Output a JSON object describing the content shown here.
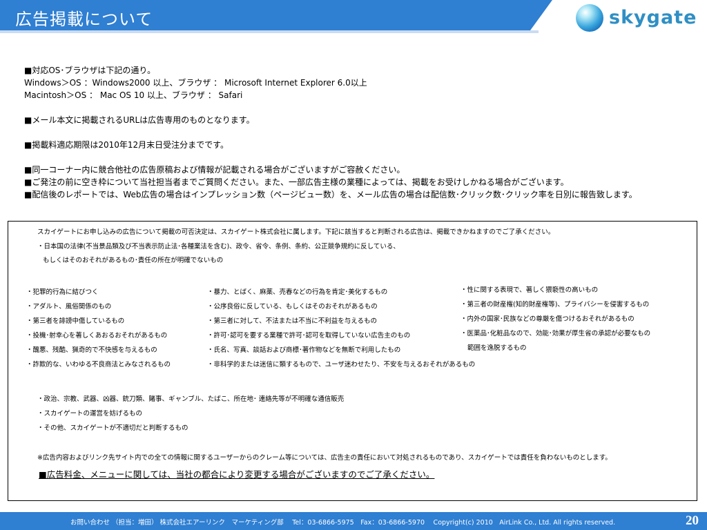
{
  "header": {
    "title": "広告掲載について",
    "logo_text": "skygate"
  },
  "info": {
    "lines": [
      "■対応OS･ブラウザは下記の通り。",
      "Windows＞OS ：Windows2000 以上、ブラウザ ： Microsoft Internet Explorer 6.0以上",
      "Macintosh＞OS ： Mac OS 10 以上、ブラウザ ： Safari",
      "■メール本文に掲載されるURLは広告専用のものとなります。",
      "■掲載料適応期限は2010年12月末日受注分までです。",
      "■同一コーナー内に競合他社の広告原稿および情報が記載される場合がございますがご容赦ください。",
      "■ご発注の前に空き枠について当社担当者までご質問ください。また、一部広告主様の業種によっては、掲載をお受けしかねる場合がございます。",
      "■配信後のレポートでは、Web広告の場合はインプレッション数（ページビュー数）を、メール広告の場合は配信数･クリック数･クリック率を日別に報告致します。"
    ]
  },
  "box": {
    "intro": "スカイゲートにお申し込みの広告について掲載の可否決定は、スカイゲート株式会社に属します。下記に該当すると判断される広告は、掲載できかねますのでご了承ください。",
    "law_line1": "・日本国の法律(不当景品類及び不当表示防止法･各種業法を含む)、政令、省令、条例、条約、公正競争規約に反している、",
    "law_line2": "もしくはそのおそれがあるもの･責任の所在が明確でないもの",
    "col1": [
      "・犯罪的行為に結びつく",
      "・アダルト、風俗関係のもの",
      "・第三者を誹謗中傷しているもの",
      "・投機･射幸心を著しくあおるおそれがあるもの",
      "・醜悪、残酷、猟奇的で不快感を与えるもの",
      "・詐欺的な、いわゆる不良商法とみなされるもの"
    ],
    "col2": [
      "・暴力、とばく、麻薬、売春などの行為を肯定･美化するもの",
      "・公序良俗に反している、もしくはそのおそれがあるもの",
      "・第三者に対して、不法または不当に不利益を与えるもの",
      "・許可･認可を要する業種で許可･認可を取得していない広告主のもの",
      "・氏名、写真、談話および商標･著作物などを無断で利用したもの",
      "・非科学的または迷信に類するもので、ユーザ迷わせたり、不安を与えるおそれがあるもの"
    ],
    "col3": [
      "・性に関する表現で、著しく猥褻性の高いもの",
      "・第三者の財産権(知的財産権等)、プライバシーを侵害するもの",
      "・内外の国家･民族などの尊厳を傷つけるおそれがあるもの",
      "・医薬品･化粧品なので、効能･効果が厚生省の承認が必要なもの",
      "範囲を逸脱するもの"
    ],
    "misc": [
      "・政治、宗教、武器、凶器、銃刀類、賭事、ギャンブル、たばこ、所在地･ 連絡先等が不明確な通信販売",
      "・スカイゲートの運営を妨げるもの",
      "・その他、スカイゲートが不適切だと判断するもの"
    ],
    "note": "※広告内容およびリンク先サイト内での全ての情報に関するユーザーからのクレーム等については、広告主の責任において対処されるものであり、スカイゲートでは責任を負わないものとします。",
    "price_note": "■広告料金、メニューに関しては、当社の都合により変更する場合がございますのでご了承ください。"
  },
  "footer": {
    "contact": "お問い合わせ （担当：増田） 株式会社エアーリンク　マーケティング部　 Tel：03-6866-5975　Fax：03-6866-5970　 Copyright(c) 2010　AirLink Co., Ltd. All rights reserved.",
    "page_number": "20"
  },
  "colors": {
    "header_blue": "#2f7fd2",
    "logo_text": "#2f8fc4",
    "footer_blue": "#2f7fd2"
  }
}
